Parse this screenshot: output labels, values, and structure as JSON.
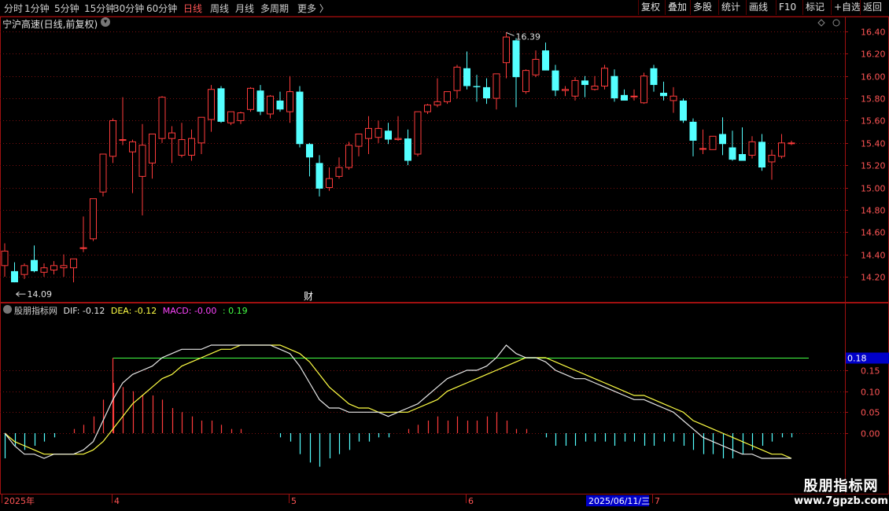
{
  "toolbar": {
    "periods": [
      "分时",
      "1分钟",
      "5分钟",
      "15分钟",
      "30分钟",
      "60分钟",
      "日线",
      "周线",
      "月线",
      "多周期",
      "更多 〉"
    ],
    "active_period": "日线",
    "right_buttons": [
      "复权",
      "叠加",
      "多股",
      "统计",
      "画线",
      "F10",
      "标记",
      "+自选",
      "返回"
    ]
  },
  "price_panel": {
    "title": "宁沪高速(日线,前复权)",
    "high_label": "16.39",
    "low_label": "14.09",
    "event_marker": "财"
  },
  "indicator": {
    "name": "股朋指标网",
    "dif_text": "DIF: -0.12",
    "dea_text": "DEA: -0.12",
    "macd_text": "MACD: -0.00",
    "extra_text": ": 0.19",
    "level_badge": "0.18"
  },
  "watermark": {
    "title": "股朋指标网",
    "url": "www.7gpzb.com"
  },
  "colors": {
    "up": "#ff3b3b",
    "down": "#54ffff",
    "dif": "#e8e8e8",
    "dea": "#ffff44",
    "level_line": "#44ff44",
    "frame": "#a01010",
    "grid": "#7a1010"
  },
  "chart_data": [
    {
      "type": "candlestick",
      "title": "宁沪高速(日线,前复权)",
      "ylim": [
        14.09,
        16.45
      ],
      "y_ticks": [
        14.2,
        14.4,
        14.6,
        14.8,
        15.0,
        15.2,
        15.4,
        15.6,
        15.8,
        16.0,
        16.2,
        16.4
      ],
      "x_ticks": [
        "2025年",
        "4",
        "5",
        "6",
        "7"
      ],
      "x_tick_index": [
        0,
        11,
        29,
        47,
        66
      ],
      "cursor_date": "2025/06/11/三",
      "cursor_index": 54,
      "ohlc": [
        [
          14.3,
          14.5,
          14.2,
          14.43
        ],
        [
          14.25,
          14.33,
          14.15,
          14.15
        ],
        [
          14.22,
          14.32,
          14.18,
          14.3
        ],
        [
          14.35,
          14.48,
          14.24,
          14.25
        ],
        [
          14.24,
          14.32,
          14.2,
          14.28
        ],
        [
          14.26,
          14.34,
          14.22,
          14.3
        ],
        [
          14.28,
          14.4,
          14.2,
          14.3
        ],
        [
          14.28,
          14.36,
          14.15,
          14.36
        ],
        [
          14.46,
          14.74,
          14.42,
          14.46
        ],
        [
          14.54,
          14.9,
          14.52,
          14.9
        ],
        [
          14.96,
          15.3,
          14.92,
          15.3
        ],
        [
          15.28,
          15.62,
          15.22,
          15.6
        ],
        [
          15.43,
          15.81,
          15.38,
          15.43
        ],
        [
          15.32,
          15.43,
          14.95,
          15.41
        ],
        [
          15.1,
          15.57,
          14.75,
          15.38
        ],
        [
          15.22,
          15.48,
          15.08,
          15.48
        ],
        [
          15.44,
          15.82,
          15.4,
          15.81
        ],
        [
          15.44,
          15.55,
          15.22,
          15.49
        ],
        [
          15.29,
          15.58,
          15.27,
          15.43
        ],
        [
          15.29,
          15.52,
          15.24,
          15.44
        ],
        [
          15.4,
          15.61,
          15.3,
          15.63
        ],
        [
          15.61,
          15.92,
          15.5,
          15.88
        ],
        [
          15.89,
          15.91,
          15.58,
          15.59
        ],
        [
          15.58,
          15.68,
          15.56,
          15.68
        ],
        [
          15.6,
          15.68,
          15.57,
          15.67
        ],
        [
          15.7,
          15.9,
          15.68,
          15.89
        ],
        [
          15.87,
          15.92,
          15.65,
          15.68
        ],
        [
          15.66,
          15.83,
          15.62,
          15.82
        ],
        [
          15.78,
          15.86,
          15.68,
          15.7
        ],
        [
          15.68,
          16.0,
          15.58,
          15.86
        ],
        [
          15.86,
          15.91,
          15.36,
          15.39
        ],
        [
          15.39,
          15.4,
          15.1,
          15.27
        ],
        [
          15.22,
          15.29,
          14.92,
          14.99
        ],
        [
          15.0,
          15.18,
          14.97,
          15.08
        ],
        [
          15.1,
          15.27,
          15.08,
          15.18
        ],
        [
          15.18,
          15.41,
          15.16,
          15.38
        ],
        [
          15.37,
          15.48,
          15.28,
          15.48
        ],
        [
          15.44,
          15.64,
          15.3,
          15.53
        ],
        [
          15.45,
          15.6,
          15.4,
          15.53
        ],
        [
          15.51,
          15.58,
          15.39,
          15.43
        ],
        [
          15.43,
          15.64,
          15.42,
          15.44
        ],
        [
          15.44,
          15.52,
          15.2,
          15.24
        ],
        [
          15.3,
          15.68,
          15.28,
          15.68
        ],
        [
          15.68,
          15.75,
          15.66,
          15.74
        ],
        [
          15.74,
          15.98,
          15.72,
          15.77
        ],
        [
          15.77,
          15.85,
          15.75,
          15.86
        ],
        [
          15.87,
          16.1,
          15.8,
          16.08
        ],
        [
          16.07,
          16.22,
          15.88,
          15.91
        ],
        [
          15.91,
          16.01,
          15.77,
          15.9
        ],
        [
          15.9,
          15.98,
          15.75,
          15.8
        ],
        [
          15.8,
          16.02,
          15.7,
          16.02
        ],
        [
          16.12,
          16.39,
          15.98,
          16.35
        ],
        [
          16.32,
          16.34,
          15.72,
          15.99
        ],
        [
          15.86,
          16.06,
          15.84,
          16.05
        ],
        [
          16.01,
          16.23,
          15.99,
          16.15
        ],
        [
          16.23,
          16.3,
          16.07,
          16.05
        ],
        [
          16.05,
          16.1,
          15.82,
          15.87
        ],
        [
          15.87,
          15.91,
          15.82,
          15.88
        ],
        [
          15.82,
          15.99,
          15.78,
          15.96
        ],
        [
          15.96,
          16.0,
          15.81,
          15.92
        ],
        [
          15.88,
          16.0,
          15.87,
          15.91
        ],
        [
          15.91,
          16.1,
          15.88,
          16.07
        ],
        [
          16.0,
          16.06,
          15.77,
          15.8
        ],
        [
          15.83,
          15.88,
          15.8,
          15.78
        ],
        [
          15.82,
          15.88,
          15.78,
          15.82
        ],
        [
          15.76,
          16.03,
          15.75,
          16.0
        ],
        [
          16.07,
          16.1,
          15.86,
          15.92
        ],
        [
          15.85,
          15.95,
          15.78,
          15.82
        ],
        [
          15.78,
          15.9,
          15.67,
          15.82
        ],
        [
          15.78,
          15.8,
          15.58,
          15.6
        ],
        [
          15.59,
          15.62,
          15.28,
          15.42
        ],
        [
          15.35,
          15.52,
          15.3,
          15.35
        ],
        [
          15.34,
          15.44,
          15.34,
          15.46
        ],
        [
          15.48,
          15.63,
          15.29,
          15.39
        ],
        [
          15.36,
          15.51,
          15.24,
          15.25
        ],
        [
          15.3,
          15.54,
          15.24,
          15.24
        ],
        [
          15.29,
          15.46,
          15.26,
          15.41
        ],
        [
          15.41,
          15.48,
          15.15,
          15.18
        ],
        [
          15.23,
          15.34,
          15.07,
          15.29
        ],
        [
          15.28,
          15.48,
          15.26,
          15.4
        ],
        [
          15.4,
          15.42,
          15.38,
          15.4
        ]
      ]
    },
    {
      "type": "line",
      "title": "股朋指标网",
      "ylim": [
        -0.06,
        0.22
      ],
      "y_ticks": [
        0.0,
        0.05,
        0.1,
        0.15,
        0.18
      ],
      "level": 0.18,
      "level_start_index": 11,
      "series": [
        {
          "name": "DIF",
          "values": [
            0.0,
            -0.03,
            -0.05,
            -0.05,
            -0.06,
            -0.05,
            -0.05,
            -0.05,
            -0.04,
            -0.02,
            0.03,
            0.08,
            0.12,
            0.14,
            0.15,
            0.16,
            0.18,
            0.19,
            0.2,
            0.2,
            0.2,
            0.21,
            0.21,
            0.21,
            0.21,
            0.21,
            0.21,
            0.21,
            0.2,
            0.19,
            0.16,
            0.12,
            0.08,
            0.06,
            0.06,
            0.05,
            0.05,
            0.05,
            0.05,
            0.04,
            0.05,
            0.06,
            0.07,
            0.09,
            0.11,
            0.13,
            0.14,
            0.15,
            0.15,
            0.16,
            0.18,
            0.21,
            0.19,
            0.18,
            0.18,
            0.17,
            0.15,
            0.14,
            0.13,
            0.13,
            0.12,
            0.11,
            0.1,
            0.09,
            0.08,
            0.08,
            0.07,
            0.06,
            0.05,
            0.03,
            0.01,
            -0.01,
            -0.02,
            -0.03,
            -0.04,
            -0.05,
            -0.05,
            -0.06,
            -0.06,
            -0.06,
            -0.06
          ]
        },
        {
          "name": "DEA",
          "values": [
            0.0,
            -0.02,
            -0.03,
            -0.04,
            -0.05,
            -0.05,
            -0.05,
            -0.05,
            -0.05,
            -0.04,
            -0.02,
            0.01,
            0.04,
            0.07,
            0.09,
            0.11,
            0.13,
            0.14,
            0.16,
            0.17,
            0.18,
            0.19,
            0.2,
            0.2,
            0.21,
            0.21,
            0.21,
            0.21,
            0.21,
            0.2,
            0.19,
            0.17,
            0.14,
            0.11,
            0.09,
            0.07,
            0.06,
            0.06,
            0.05,
            0.05,
            0.05,
            0.05,
            0.06,
            0.07,
            0.08,
            0.1,
            0.11,
            0.12,
            0.13,
            0.14,
            0.15,
            0.16,
            0.17,
            0.18,
            0.18,
            0.18,
            0.17,
            0.16,
            0.15,
            0.14,
            0.13,
            0.12,
            0.11,
            0.1,
            0.09,
            0.09,
            0.08,
            0.07,
            0.06,
            0.05,
            0.03,
            0.02,
            0.01,
            0.0,
            -0.01,
            -0.02,
            -0.03,
            -0.04,
            -0.05,
            -0.05,
            -0.06
          ]
        },
        {
          "name": "MACD",
          "type": "bar",
          "values": [
            -0.06,
            -0.03,
            -0.04,
            -0.03,
            -0.02,
            -0.01,
            0.0,
            0.01,
            0.02,
            0.04,
            0.08,
            0.12,
            0.11,
            0.1,
            0.09,
            0.09,
            0.08,
            0.06,
            0.05,
            0.04,
            0.03,
            0.03,
            0.02,
            0.01,
            0.01,
            0.0,
            0.0,
            0.0,
            -0.01,
            -0.02,
            -0.05,
            -0.07,
            -0.08,
            -0.06,
            -0.05,
            -0.04,
            -0.02,
            -0.02,
            -0.01,
            -0.01,
            0.0,
            0.01,
            0.02,
            0.03,
            0.04,
            0.03,
            0.04,
            0.03,
            0.03,
            0.04,
            0.05,
            0.03,
            0.01,
            0.01,
            0.0,
            -0.01,
            -0.03,
            -0.03,
            -0.03,
            -0.02,
            -0.02,
            -0.02,
            -0.03,
            -0.02,
            -0.02,
            -0.03,
            -0.03,
            -0.02,
            -0.02,
            -0.03,
            -0.04,
            -0.05,
            -0.05,
            -0.06,
            -0.06,
            -0.05,
            -0.04,
            -0.03,
            -0.02,
            -0.01,
            -0.01
          ]
        }
      ]
    }
  ]
}
